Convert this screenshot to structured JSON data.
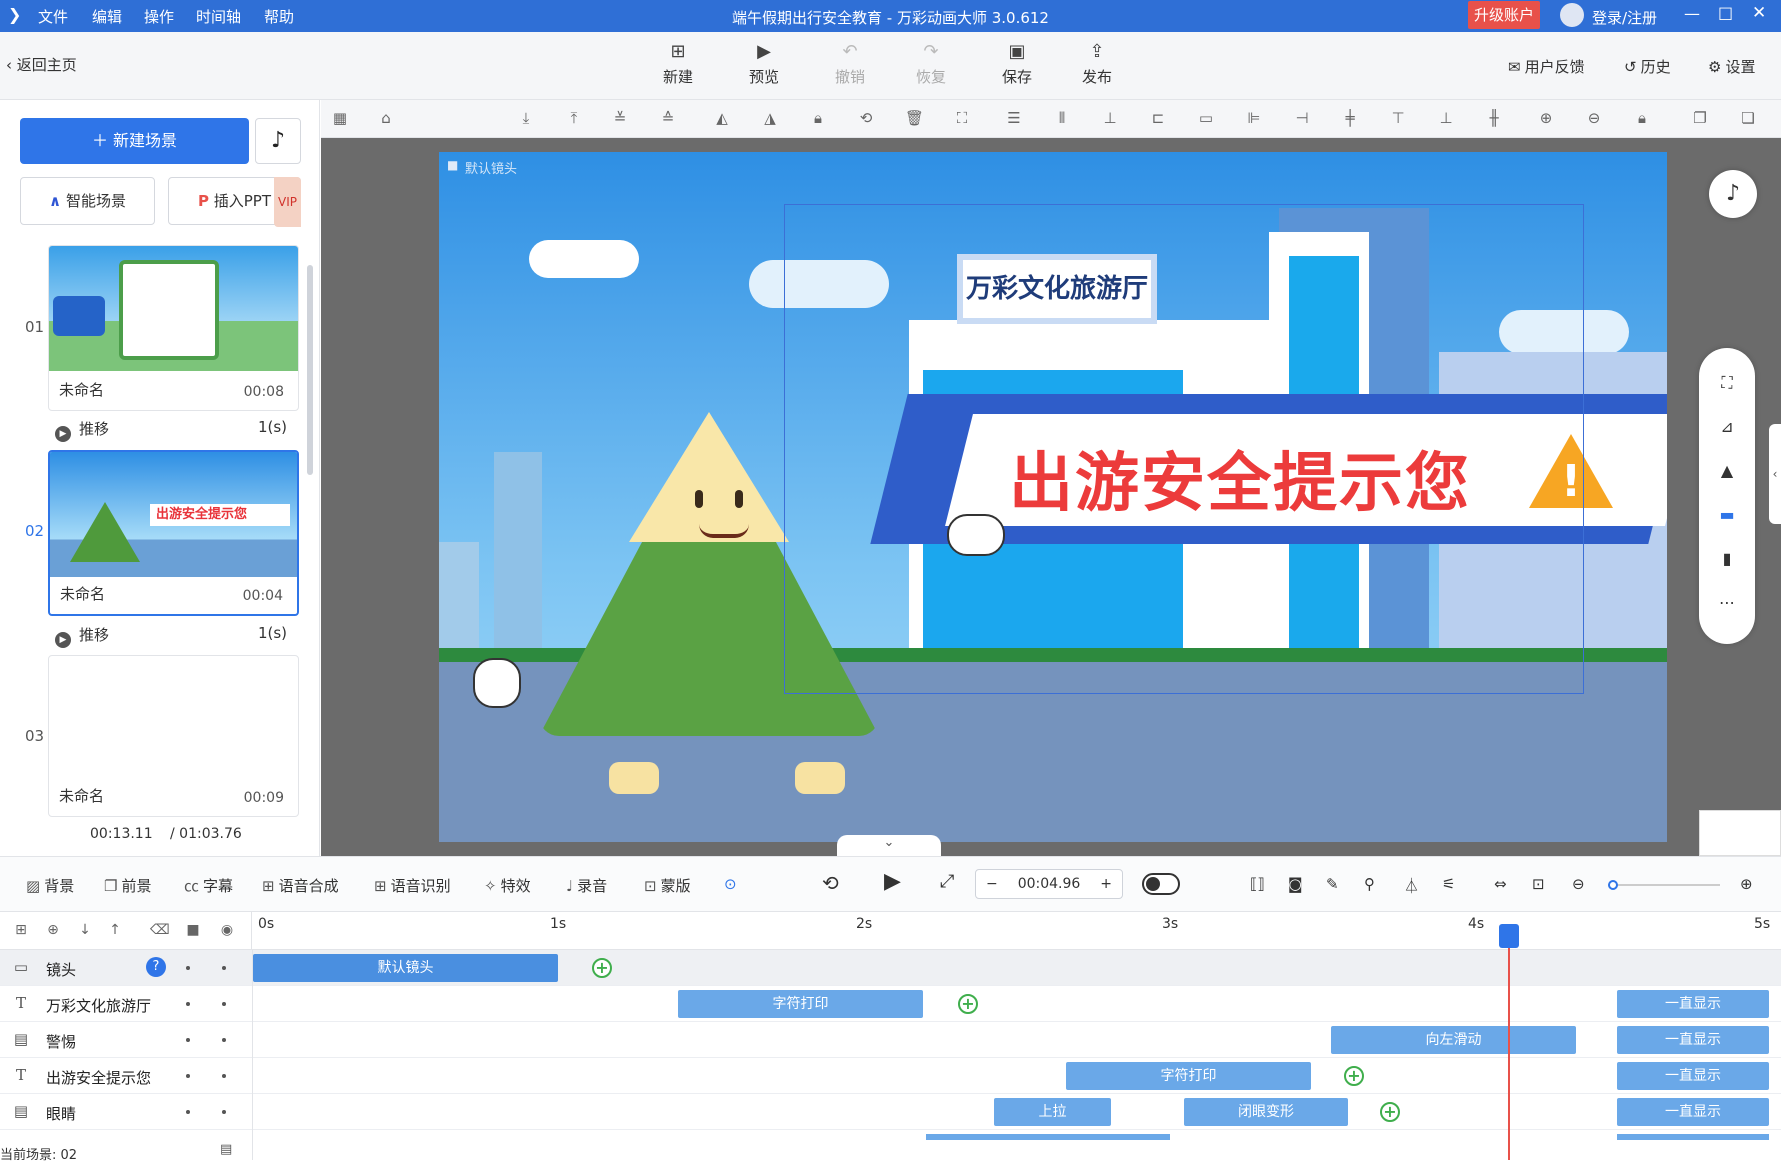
{
  "titlebar": {
    "menus": [
      "文件",
      "编辑",
      "操作",
      "时间轴",
      "帮助"
    ],
    "title": "端午假期出行安全教育 - 万彩动画大师 3.0.612",
    "upgrade": "升级账户",
    "login": "登录/注册"
  },
  "toolbar": {
    "back": "返回主页",
    "new": "新建",
    "preview": "预览",
    "undo": "撤销",
    "redo": "恢复",
    "save": "保存",
    "publish": "发布",
    "feedback": "用户反馈",
    "history": "历史",
    "settings": "设置"
  },
  "left": {
    "new_scene": "新建场景",
    "smart_scene": "智能场景",
    "insert_ppt": "插入PPT",
    "vip": "VIP",
    "scenes": [
      {
        "num": "01",
        "name": "未命名",
        "time": "00:08",
        "trans": "推移",
        "trans_dur": "1(s)"
      },
      {
        "num": "02",
        "name": "未命名",
        "time": "00:04",
        "trans": "推移",
        "trans_dur": "1(s)"
      },
      {
        "num": "03",
        "name": "未命名",
        "time": "00:09"
      }
    ],
    "current_time": "00:13.11",
    "total_time": "/ 01:03.76"
  },
  "stage": {
    "camera_label": "默认镜头",
    "building_sign": "万彩文化旅游厅",
    "banner_text": "出游安全提示您",
    "warning": "!"
  },
  "bottom": {
    "items": [
      "背景",
      "前景",
      "字幕",
      "语音合成",
      "语音识别",
      "特效",
      "录音",
      "蒙版"
    ],
    "time_value": "00:04.96"
  },
  "timeline": {
    "ruler": [
      "0s",
      "1s",
      "2s",
      "3s",
      "4s",
      "5s"
    ],
    "tracks": [
      {
        "name": "镜头",
        "clips": [
          "默认镜头"
        ]
      },
      {
        "name": "万彩文化旅游厅",
        "clips": [
          "字符打印",
          "一直显示"
        ]
      },
      {
        "name": "警惕",
        "clips": [
          "向左滑动",
          "一直显示"
        ]
      },
      {
        "name": "出游安全提示您",
        "clips": [
          "字符打印",
          "一直显示"
        ]
      },
      {
        "name": "眼睛",
        "clips": [
          "上拉",
          "闭眼变形",
          "一直显示"
        ]
      }
    ],
    "current_scene": "当前场景: 02"
  },
  "colors": {
    "accent": "#2f75e8",
    "titlebar": "#2f6fd6",
    "keyframe": "#3fae4c",
    "playhead": "#e8514a"
  }
}
